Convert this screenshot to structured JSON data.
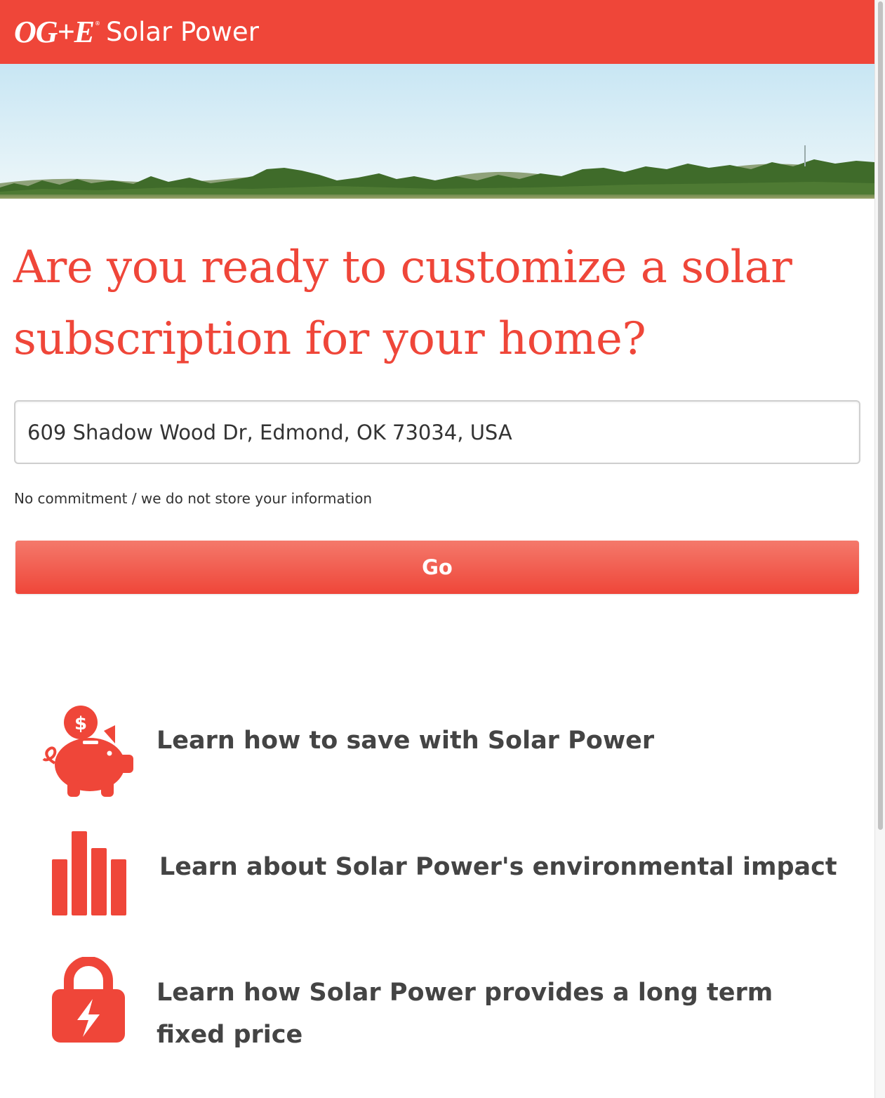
{
  "header": {
    "logo_mark": "OG+E",
    "logo_registered": "®",
    "title": "Solar Power"
  },
  "banner": {
    "icon": "landscape-photo"
  },
  "main": {
    "headline_line1": "Are you ready to customize a solar",
    "headline_line2": "subscription for your home?",
    "address_value": "609 Shadow Wood Dr, Edmond, OK 73034, USA",
    "disclaimer": "No commitment / we do not store your information",
    "go_label": "Go"
  },
  "features": [
    {
      "icon": "piggy-bank-icon",
      "label": "Learn how to save with Solar Power"
    },
    {
      "icon": "bar-chart-icon",
      "label": "Learn about Solar Power's environmental impact"
    },
    {
      "icon": "lock-icon",
      "label": "Learn how Solar Power provides a long term fixed price"
    }
  ],
  "colors": {
    "brand": "#ef4639",
    "text": "#444444",
    "sky_top": "#c8e6f4",
    "sky_bottom": "#e6f4f9",
    "trees": "#3f6b2a"
  }
}
